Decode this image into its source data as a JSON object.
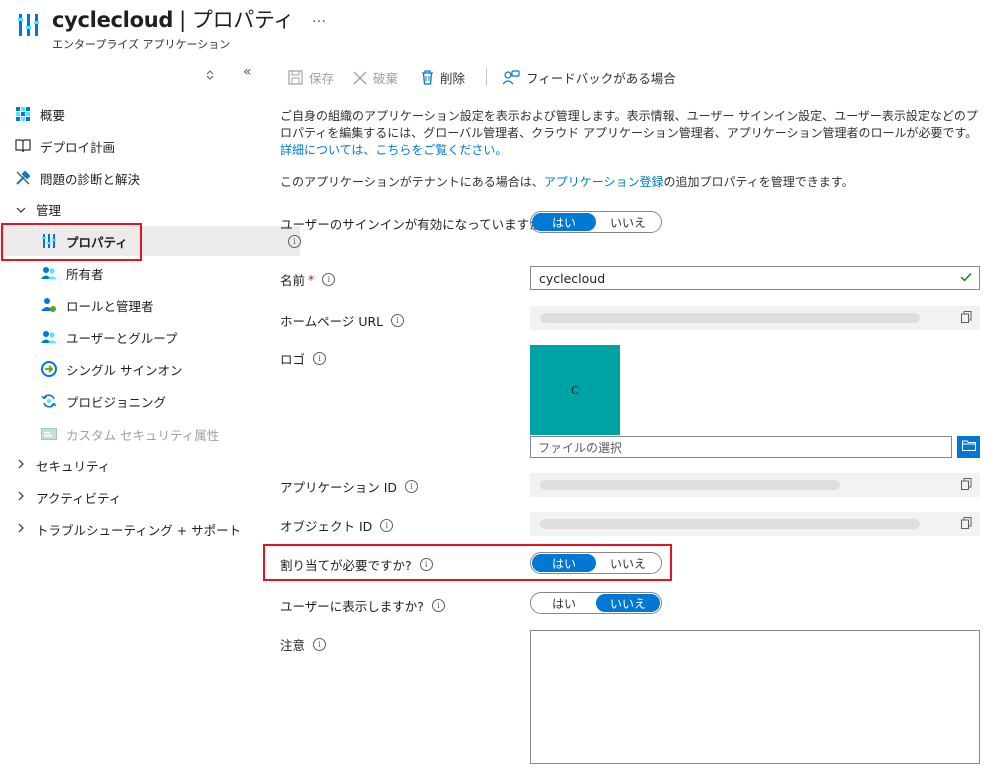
{
  "header": {
    "app_name": "cyclecloud",
    "separator": "|",
    "page_name": "プロパティ",
    "more": "…",
    "subtitle": "エンタープライズ アプリケーション"
  },
  "sidebar": {
    "updown_icon": "updown-icon",
    "collapse": "«",
    "items": [
      {
        "label": "概要",
        "icon": "overview-grid-icon"
      },
      {
        "label": "デプロイ計画",
        "icon": "book-icon"
      },
      {
        "label": "問題の診断と解決",
        "icon": "wrench-icon"
      },
      {
        "label": "管理",
        "icon": "chevron-down-icon",
        "expanded": true
      },
      {
        "label": "プロパティ",
        "icon": "properties-icon",
        "selected": true
      },
      {
        "label": "所有者",
        "icon": "owners-icon"
      },
      {
        "label": "ロールと管理者",
        "icon": "roles-icon"
      },
      {
        "label": "ユーザーとグループ",
        "icon": "users-groups-icon"
      },
      {
        "label": "シングル サインオン",
        "icon": "sso-icon"
      },
      {
        "label": "プロビジョニング",
        "icon": "provisioning-icon"
      },
      {
        "label": "カスタム セキュリティ属性",
        "icon": "custom-security-icon",
        "disabled": true
      },
      {
        "label": "セキュリティ",
        "icon": "chevron-right-icon"
      },
      {
        "label": "アクティビティ",
        "icon": "chevron-right-icon"
      },
      {
        "label": "トラブルシューティング + サポート",
        "icon": "chevron-right-icon"
      }
    ]
  },
  "toolbar": {
    "save": "保存",
    "discard": "破棄",
    "delete": "削除",
    "feedback": "フィードバックがある場合"
  },
  "description": {
    "para1": "ご自身の組織のアプリケーション設定を表示および管理します。表示情報、ユーザー サインイン設定、ユーザー表示設定などのプロパティを編集するには、グローバル管理者、クラウド アプリケーション管理者、アプリケーション管理者のロールが必要です。",
    "para1_link": "詳細については、こちらをご覧ください。",
    "para2_pre": "このアプリケーションがテナントにある場合は、",
    "para2_link": "アプリケーション登録",
    "para2_post": "の追加プロパティを管理できます。"
  },
  "form": {
    "signin_enabled": {
      "label": "ユーザーのサインインが有効になっていますか?",
      "yes": "はい",
      "no": "いいえ",
      "value": "はい"
    },
    "name": {
      "label": "名前",
      "required_mark": "*",
      "value": "cyclecloud"
    },
    "homepage": {
      "label": "ホームページ URL"
    },
    "logo": {
      "label": "ロゴ",
      "tile_letter": "C",
      "file_placeholder": "ファイルの選択",
      "tile_color": "#00a3a3"
    },
    "app_id": {
      "label": "アプリケーション ID"
    },
    "object_id": {
      "label": "オブジェクト ID"
    },
    "assignment_required": {
      "label": "割り当てが必要ですか?",
      "yes": "はい",
      "no": "いいえ",
      "value": "はい"
    },
    "visible_to_users": {
      "label": "ユーザーに表示しますか?",
      "yes": "はい",
      "no": "いいえ",
      "value": "いいえ"
    },
    "notes": {
      "label": "注意",
      "value": ""
    }
  },
  "colors": {
    "accent": "#0078d4",
    "highlight": "#e81123"
  }
}
